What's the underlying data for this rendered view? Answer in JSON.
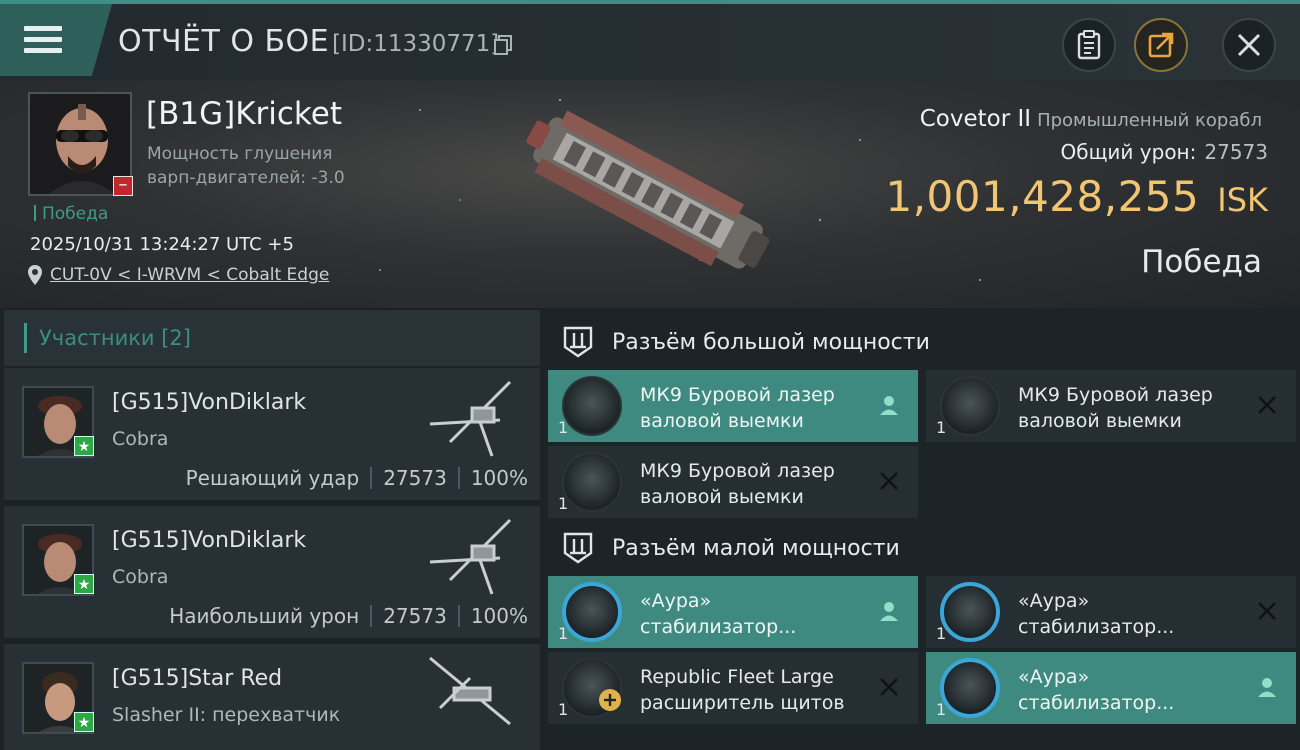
{
  "topbar": {
    "title": "ОТЧЁТ О БОЕ",
    "report_id": "[ID:11330771]"
  },
  "header": {
    "pilot_name": "[B1G]Kricket",
    "warp_text": "Мощность глушения варп-двигателей: -3.0",
    "outcome_tag": "Победа",
    "datetime": "2025/10/31 13:24:27 UTC +5",
    "location": "CUT-0V < I-WRVM < Cobalt Edge",
    "ship_name": "Covetor II",
    "ship_class": "Промышленный корабл",
    "damage_label": "Общий урон:",
    "damage_value": "27573",
    "isk_value": "1,001,428,255",
    "isk_unit": "ISK",
    "result": "Победа"
  },
  "participants": {
    "header": "Участники [2]",
    "rows": [
      {
        "name": "[G515]VonDiklark",
        "ship": "Cobra",
        "role": "Решающий удар",
        "damage": "27573",
        "percent": "100%"
      },
      {
        "name": "[G515]VonDiklark",
        "ship": "Cobra",
        "role": "Наибольший урон",
        "damage": "27573",
        "percent": "100%"
      },
      {
        "name": "[G515]Star Red",
        "ship": "Slasher II: перехватчик"
      }
    ]
  },
  "fitting": {
    "high_title": "Разъём большой мощности",
    "low_title": "Разъём малой мощности",
    "high_modules": [
      {
        "name": "МК9 Буровой лазер валовой выемки",
        "qty": "1",
        "state": "teal",
        "action": "person-icon"
      },
      {
        "name": "МК9 Буровой лазер валовой выемки",
        "qty": "1",
        "state": "dark",
        "action": "x-icon"
      },
      {
        "name": "МК9 Буровой лазер валовой выемки",
        "qty": "1",
        "state": "dark",
        "action": "x-icon"
      }
    ],
    "low_modules": [
      {
        "name": "«Аура» стабилизатор...",
        "qty": "1",
        "state": "teal",
        "action": "person-icon"
      },
      {
        "name": "«Аура» стабилизатор...",
        "qty": "1",
        "state": "dark",
        "action": "x-icon"
      },
      {
        "name": "Republic Fleet Large расширитель щитов",
        "qty": "1",
        "state": "dark",
        "action": "x-icon"
      },
      {
        "name": "«Аура» стабилизатор...",
        "qty": "1",
        "state": "teal",
        "action": "person-icon"
      }
    ]
  },
  "colors": {
    "accent_teal": "#3f8a80",
    "isk_gold": "#f1c572",
    "victory_green": "#3f9b87",
    "minus_red": "#c3262c"
  }
}
